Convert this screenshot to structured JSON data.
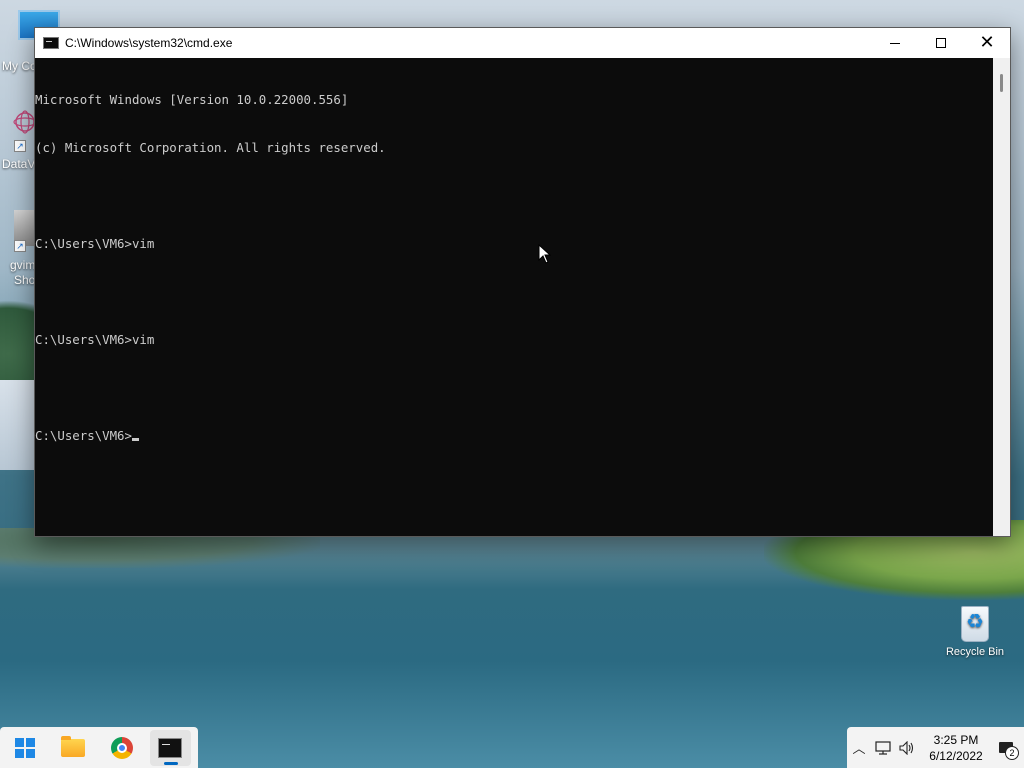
{
  "desktop": {
    "icons": [
      {
        "label": "My Co",
        "icon": "computer-icon"
      },
      {
        "label": "DataV",
        "icon": "data-app-icon"
      },
      {
        "label": "gvim",
        "label2": "Sho",
        "icon": "gvim-icon"
      },
      {
        "label": "Recycle Bin",
        "icon": "recycle-bin-icon"
      }
    ]
  },
  "window": {
    "title": "C:\\Windows\\system32\\cmd.exe",
    "buttons": {
      "minimize": "minimize",
      "maximize": "maximize",
      "close": "close"
    }
  },
  "console": {
    "lines": [
      "Microsoft Windows [Version 10.0.22000.556]",
      "(c) Microsoft Corporation. All rights reserved.",
      "",
      "C:\\Users\\VM6>vim",
      "",
      "C:\\Users\\VM6>vim",
      "",
      "C:\\Users\\VM6>"
    ],
    "colors": {
      "background": "#0c0c0c",
      "text": "#cccccc"
    }
  },
  "taskbar": {
    "apps": [
      {
        "name": "Start",
        "icon": "windows-start-icon"
      },
      {
        "name": "File Explorer",
        "icon": "folder-icon"
      },
      {
        "name": "Google Chrome",
        "icon": "chrome-icon"
      },
      {
        "name": "Command Prompt",
        "icon": "cmd-icon",
        "active": true
      }
    ],
    "tray": {
      "time": "3:25 PM",
      "date": "6/12/2022",
      "notification_count": "2"
    },
    "accent": "#0067c0"
  }
}
